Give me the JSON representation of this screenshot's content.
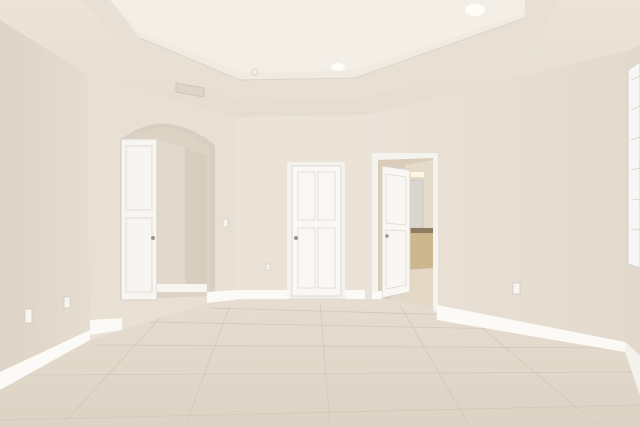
{
  "scene": {
    "subject": "empty-room-interior",
    "colors": {
      "wall": "#ebe3d8",
      "wall_shade": "#e2d8cc",
      "ceiling": "#eee7dd",
      "tray_ceiling": "#f2ece3",
      "floor": "#e8dfd2",
      "baseboard": "#fbfaf7",
      "door": "#f7f6f2",
      "door_frame": "#f3f1ec"
    }
  }
}
